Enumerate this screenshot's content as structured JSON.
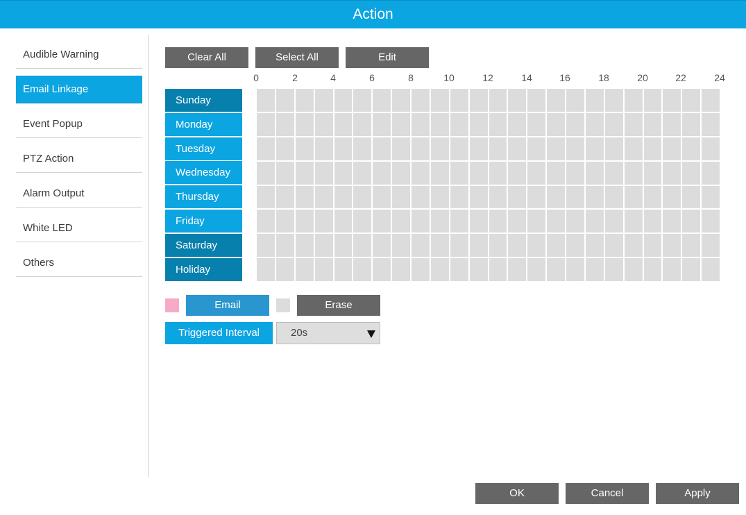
{
  "window": {
    "title": "Action"
  },
  "sidebar": {
    "items": [
      {
        "label": "Audible Warning",
        "active": false
      },
      {
        "label": "Email Linkage",
        "active": true
      },
      {
        "label": "Event Popup",
        "active": false
      },
      {
        "label": "PTZ Action",
        "active": false
      },
      {
        "label": "Alarm Output",
        "active": false
      },
      {
        "label": "White LED",
        "active": false
      },
      {
        "label": "Others",
        "active": false
      }
    ]
  },
  "toolbar": {
    "clear_all": "Clear All",
    "select_all": "Select All",
    "edit": "Edit"
  },
  "schedule": {
    "hours": [
      "0",
      "2",
      "4",
      "6",
      "8",
      "10",
      "12",
      "14",
      "16",
      "18",
      "20",
      "22",
      "24"
    ],
    "days": [
      "Sunday",
      "Monday",
      "Tuesday",
      "Wednesday",
      "Thursday",
      "Friday",
      "Saturday",
      "Holiday"
    ]
  },
  "legend": {
    "email_label": "Email",
    "erase_label": "Erase",
    "email_color": "#f7aac8",
    "erase_color": "#dcdcdc"
  },
  "interval": {
    "label": "Triggered Interval",
    "value": "20s"
  },
  "footer": {
    "ok": "OK",
    "cancel": "Cancel",
    "apply": "Apply"
  },
  "colors": {
    "accent": "#0ba5e2",
    "accent_dark": "#0780ad",
    "button": "#666666"
  }
}
